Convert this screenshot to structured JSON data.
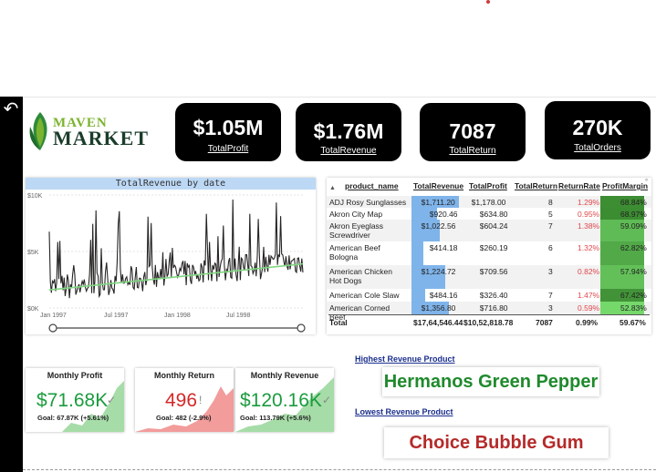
{
  "brand": {
    "line1": "MAVEN",
    "line2": "MARKET"
  },
  "kpis": [
    {
      "value": "$1.05M",
      "label": "TotalProfit"
    },
    {
      "value": "$1.76M",
      "label": "TotalRevenue"
    },
    {
      "value": "7087",
      "label": "TotalReturn"
    },
    {
      "value": "270K",
      "label": "TotalOrders"
    }
  ],
  "chart_data": {
    "type": "line",
    "title": "TotalRevenue by date",
    "y_ticks": [
      "$10K",
      "$5K",
      "$0K"
    ],
    "x_ticks": [
      "Jan 1997",
      "Jul 1997",
      "Jan 1998",
      "Jul 1998"
    ],
    "ylim": [
      0,
      10000
    ],
    "series": [
      {
        "kind": "daily",
        "color": "#252423"
      },
      {
        "kind": "trend",
        "color": "#7fd67f",
        "start": 1600,
        "end": 3900
      }
    ],
    "grid": true
  },
  "table": {
    "headers": [
      "product_name",
      "TotalRevenue",
      "TotalProfit",
      "TotalReturn",
      "ReturnRate",
      "ProfitMargin"
    ],
    "rows": [
      {
        "name": "ADJ Rosy Sunglasses",
        "revenue": "$1,711.20",
        "profit": "$1,178.00",
        "ret": "8",
        "rate": "1.29%",
        "margin": "68.84%",
        "revenue_value": 1711.2,
        "margin_value": 68.84
      },
      {
        "name": "Akron City Map",
        "revenue": "$920.46",
        "profit": "$634.80",
        "ret": "5",
        "rate": "0.95%",
        "margin": "68.97%",
        "revenue_value": 920.46,
        "margin_value": 68.97
      },
      {
        "name": "Akron Eyeglass Screwdriver",
        "name2": "Screwdriver",
        "name1": "Akron Eyeglass",
        "revenue": "$1,022.56",
        "profit": "$604.24",
        "ret": "7",
        "rate": "1.38%",
        "margin": "59.09%",
        "revenue_value": 1022.56,
        "margin_value": 59.09
      },
      {
        "name1": "American Beef",
        "name2": "Bologna",
        "revenue": "$414.18",
        "profit": "$260.19",
        "ret": "6",
        "rate": "1.32%",
        "margin": "62.82%",
        "revenue_value": 414.18,
        "margin_value": 62.82
      },
      {
        "name1": "American Chicken",
        "name2": "Hot Dogs",
        "revenue": "$1,224.72",
        "profit": "$709.56",
        "ret": "3",
        "rate": "0.82%",
        "margin": "57.94%",
        "revenue_value": 1224.72,
        "margin_value": 57.94
      },
      {
        "name": "American Cole Slaw",
        "revenue": "$484.16",
        "profit": "$326.40",
        "ret": "7",
        "rate": "1.47%",
        "margin": "67.42%",
        "revenue_value": 484.16,
        "margin_value": 67.42
      },
      {
        "name1": "American Corned",
        "name2": "Beef",
        "revenue": "$1,356.80",
        "profit": "$716.80",
        "ret": "3",
        "rate": "0.59%",
        "margin": "52.83%",
        "revenue_value": 1356.8,
        "margin_value": 52.83
      }
    ],
    "total": {
      "label": "Total",
      "revenue": "$17,64,546.44",
      "profit": "$10,52,818.78",
      "ret": "7087",
      "rate": "0.99%",
      "margin": "59.67%"
    }
  },
  "monthly": [
    {
      "title": "Monthly Profit",
      "value": "$71.68K",
      "goal": "Goal: 67.87K (+5.61%)",
      "color": "#1a9c3e",
      "fill": "#a6dca8"
    },
    {
      "title": "Monthly Return",
      "value": "496",
      "goal": "Goal: 482 (-2.9%)",
      "color": "#d62828",
      "fill": "#f29c9c"
    },
    {
      "title": "Monthly Revenue",
      "value": "$120.16K",
      "goal": "Goal: 113.79K (+5.6%)",
      "color": "#1a9c3e",
      "fill": "#a6dca8"
    }
  ],
  "highlights": {
    "highest_label": "Highest Revenue Product",
    "highest_value": "Hermanos Green Pepper",
    "highest_color": "#1f8a2c",
    "lowest_label": "Lowest Revenue Product",
    "lowest_value": "Choice Bubble Gum",
    "lowest_color": "#b52a2a"
  }
}
